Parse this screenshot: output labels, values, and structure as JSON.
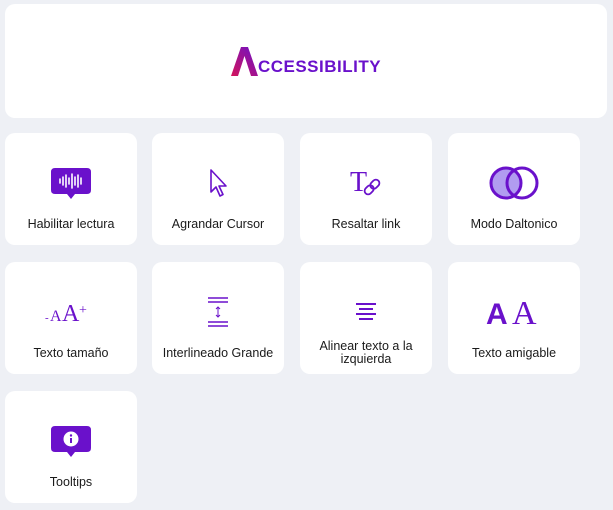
{
  "header": {
    "logo_text": "CCESSIBILITY",
    "brand_color": "#6a11cb"
  },
  "tiles": [
    {
      "label": "Habilitar lectura",
      "icon": "audio-message-icon"
    },
    {
      "label": "Agrandar Cursor",
      "icon": "cursor-icon"
    },
    {
      "label": "Resaltar link",
      "icon": "text-link-icon"
    },
    {
      "label": "Modo Daltonico",
      "icon": "overlapping-circles-icon"
    },
    {
      "label": "Texto tamaño",
      "icon": "text-size-icon"
    },
    {
      "label": "Interlineado Grande",
      "icon": "line-height-icon"
    },
    {
      "label": "Alinear texto a la izquierda",
      "icon": "align-text-icon"
    },
    {
      "label": "Texto amigable",
      "icon": "friendly-font-icon"
    },
    {
      "label": "Tooltips",
      "icon": "info-bubble-icon"
    }
  ]
}
